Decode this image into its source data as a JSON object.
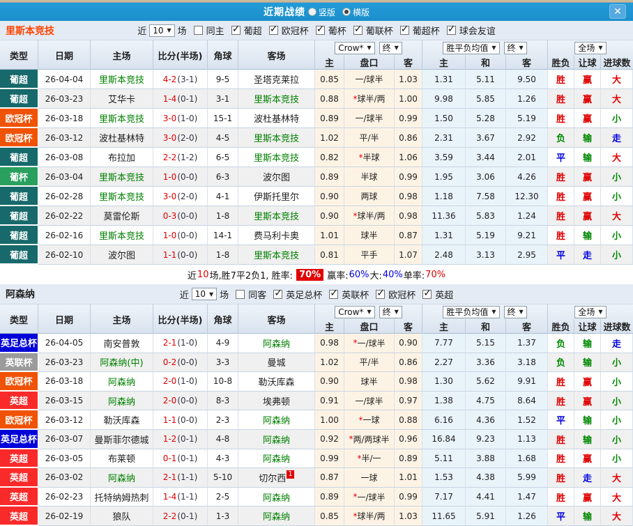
{
  "titlebar": {
    "title": "近期战绩",
    "radios": [
      {
        "label": "竖版",
        "checked": false
      },
      {
        "label": "横版",
        "checked": true
      }
    ],
    "close_label": "✕"
  },
  "table_header": {
    "type": "类型",
    "date": "日期",
    "home": "主场",
    "score": "比分(半场)",
    "corner": "角球",
    "away": "客场",
    "odds_source_dropdown": "Crow*",
    "final_dropdown": "终",
    "odds_cols": [
      "主",
      "盘口",
      "客"
    ],
    "avg_dropdown": "胜平负均值",
    "avg_final_dropdown": "终",
    "avg_cols": [
      "主",
      "和",
      "客"
    ],
    "full_dropdown": "全场",
    "result_cols": [
      "胜负",
      "让球",
      "进球数"
    ]
  },
  "league_colors": {
    "葡超": "#17696b",
    "欧冠杯": "#f05206",
    "葡杯": "#2aa05f",
    "英足总杯": "#0000d9",
    "英联杯": "#9b9b9b",
    "英超": "#fb2a2a"
  },
  "result_colors": {
    "胜": "red",
    "负": "green",
    "平": "blue",
    "赢": "red",
    "输": "green",
    "走": "blue",
    "大": "red",
    "小": "green"
  },
  "sections": [
    {
      "team": "里斯本竞技",
      "team_color": "#ff4400",
      "filter": {
        "near": "近",
        "count": "10",
        "unit": "场",
        "toggle": "同主",
        "toggle_checked": false,
        "leagues": [
          "葡超",
          "欧冠杯",
          "葡杯",
          "葡联杯",
          "葡超杯",
          "球会友谊"
        ]
      },
      "rows": [
        {
          "league": "葡超",
          "date": "26-04-04",
          "home": "里斯本竞技",
          "home_focal": true,
          "score": "4-2",
          "half": "(3-1)",
          "corner": "9-5",
          "away": "圣塔克莱拉",
          "away_focal": false,
          "away_sup": "",
          "o1": "0.85",
          "hcp": "一/球半",
          "o2": "1.03",
          "a1": "1.31",
          "a2": "5.11",
          "a3": "9.50",
          "r1": "胜",
          "r2": "赢",
          "r3": "大"
        },
        {
          "league": "葡超",
          "date": "26-03-23",
          "home": "艾华卡",
          "home_focal": false,
          "score": "1-4",
          "half": "(0-1)",
          "corner": "3-1",
          "away": "里斯本竞技",
          "away_focal": true,
          "away_sup": "",
          "o1": "0.88",
          "hcp": "*球半/两",
          "o2": "1.00",
          "a1": "9.98",
          "a2": "5.85",
          "a3": "1.26",
          "r1": "胜",
          "r2": "赢",
          "r3": "大"
        },
        {
          "league": "欧冠杯",
          "date": "26-03-18",
          "home": "里斯本竞技",
          "home_focal": true,
          "score": "3-0",
          "half": "(1-0)",
          "corner": "15-1",
          "away": "波杜基林特",
          "away_focal": false,
          "away_sup": "",
          "o1": "0.89",
          "hcp": "一/球半",
          "o2": "0.99",
          "a1": "1.50",
          "a2": "5.28",
          "a3": "5.19",
          "r1": "胜",
          "r2": "赢",
          "r3": "小"
        },
        {
          "league": "欧冠杯",
          "date": "26-03-12",
          "home": "波杜基林特",
          "home_focal": false,
          "score": "3-0",
          "half": "(2-0)",
          "corner": "4-5",
          "away": "里斯本竞技",
          "away_focal": true,
          "away_sup": "",
          "o1": "1.02",
          "hcp": "平/半",
          "o2": "0.86",
          "a1": "2.31",
          "a2": "3.67",
          "a3": "2.92",
          "r1": "负",
          "r2": "输",
          "r3": "走"
        },
        {
          "league": "葡超",
          "date": "26-03-08",
          "home": "布拉加",
          "home_focal": false,
          "score": "2-2",
          "half": "(1-2)",
          "corner": "6-5",
          "away": "里斯本竞技",
          "away_focal": true,
          "away_sup": "",
          "o1": "0.82",
          "hcp": "*半球",
          "o2": "1.06",
          "a1": "3.59",
          "a2": "3.44",
          "a3": "2.01",
          "r1": "平",
          "r2": "输",
          "r3": "大"
        },
        {
          "league": "葡杯",
          "date": "26-03-04",
          "home": "里斯本竞技",
          "home_focal": true,
          "score": "1-0",
          "half": "(0-0)",
          "corner": "6-3",
          "away": "波尔图",
          "away_focal": false,
          "away_sup": "",
          "o1": "0.89",
          "hcp": "半球",
          "o2": "0.99",
          "a1": "1.95",
          "a2": "3.06",
          "a3": "4.26",
          "r1": "胜",
          "r2": "赢",
          "r3": "小"
        },
        {
          "league": "葡超",
          "date": "26-02-28",
          "home": "里斯本竞技",
          "home_focal": true,
          "score": "3-0",
          "half": "(2-0)",
          "corner": "4-1",
          "away": "伊斯托里尔",
          "away_focal": false,
          "away_sup": "",
          "o1": "0.90",
          "hcp": "两球",
          "o2": "0.98",
          "a1": "1.18",
          "a2": "7.58",
          "a3": "12.30",
          "r1": "胜",
          "r2": "赢",
          "r3": "小"
        },
        {
          "league": "葡超",
          "date": "26-02-22",
          "home": "莫雷伦斯",
          "home_focal": false,
          "score": "0-3",
          "half": "(0-0)",
          "corner": "1-8",
          "away": "里斯本竞技",
          "away_focal": true,
          "away_sup": "",
          "o1": "0.90",
          "hcp": "*球半/两",
          "o2": "0.98",
          "a1": "11.36",
          "a2": "5.83",
          "a3": "1.24",
          "r1": "胜",
          "r2": "赢",
          "r3": "大"
        },
        {
          "league": "葡超",
          "date": "26-02-16",
          "home": "里斯本竞技",
          "home_focal": true,
          "score": "1-0",
          "half": "(0-0)",
          "corner": "14-1",
          "away": "费马利卡奥",
          "away_focal": false,
          "away_sup": "",
          "o1": "1.01",
          "hcp": "球半",
          "o2": "0.87",
          "a1": "1.31",
          "a2": "5.19",
          "a3": "9.21",
          "r1": "胜",
          "r2": "输",
          "r3": "小"
        },
        {
          "league": "葡超",
          "date": "26-02-10",
          "home": "波尔图",
          "home_focal": false,
          "score": "1-1",
          "half": "(0-0)",
          "corner": "1-8",
          "away": "里斯本竞技",
          "away_focal": true,
          "away_sup": "",
          "o1": "0.81",
          "hcp": "平手",
          "o2": "1.07",
          "a1": "2.48",
          "a2": "3.13",
          "a3": "2.95",
          "r1": "平",
          "r2": "走",
          "r3": "小"
        }
      ],
      "summary": [
        {
          "text": "近",
          "style": "plain"
        },
        {
          "text": "10",
          "style": "red"
        },
        {
          "text": "场,胜7平2负1, 胜率:",
          "style": "plain"
        },
        {
          "text": "70%",
          "style": "badge"
        },
        {
          "text": "赢率:",
          "style": "plain"
        },
        {
          "text": "60%",
          "style": "blue"
        },
        {
          "text": " 大:",
          "style": "plain"
        },
        {
          "text": "40%",
          "style": "blue"
        },
        {
          "text": " 单率:",
          "style": "plain"
        },
        {
          "text": "70%",
          "style": "red"
        }
      ]
    },
    {
      "team": "阿森纳",
      "team_color": "#222222",
      "filter": {
        "near": "近",
        "count": "10",
        "unit": "场",
        "toggle": "同客",
        "toggle_checked": false,
        "leagues": [
          "英足总杯",
          "英联杯",
          "欧冠杯",
          "英超"
        ]
      },
      "rows": [
        {
          "league": "英足总杯",
          "date": "26-04-05",
          "home": "南安普敦",
          "home_focal": false,
          "score": "2-1",
          "half": "(1-0)",
          "corner": "4-9",
          "away": "阿森纳",
          "away_focal": true,
          "away_sup": "",
          "o1": "0.98",
          "hcp": "*一/球半",
          "o2": "0.90",
          "a1": "7.77",
          "a2": "5.15",
          "a3": "1.37",
          "r1": "负",
          "r2": "输",
          "r3": "走"
        },
        {
          "league": "英联杯",
          "date": "26-03-23",
          "home": "阿森纳(中)",
          "home_focal": true,
          "score": "0-2",
          "half": "(0-0)",
          "corner": "3-3",
          "away": "曼城",
          "away_focal": false,
          "away_sup": "",
          "o1": "1.02",
          "hcp": "平/半",
          "o2": "0.86",
          "a1": "2.27",
          "a2": "3.36",
          "a3": "3.18",
          "r1": "负",
          "r2": "输",
          "r3": "小"
        },
        {
          "league": "欧冠杯",
          "date": "26-03-18",
          "home": "阿森纳",
          "home_focal": true,
          "score": "2-0",
          "half": "(1-0)",
          "corner": "10-8",
          "away": "勒沃库森",
          "away_focal": false,
          "away_sup": "",
          "o1": "0.90",
          "hcp": "球半",
          "o2": "0.98",
          "a1": "1.30",
          "a2": "5.62",
          "a3": "9.91",
          "r1": "胜",
          "r2": "赢",
          "r3": "小"
        },
        {
          "league": "英超",
          "date": "26-03-15",
          "home": "阿森纳",
          "home_focal": true,
          "score": "2-0",
          "half": "(0-0)",
          "corner": "8-3",
          "away": "埃弗顿",
          "away_focal": false,
          "away_sup": "",
          "o1": "0.91",
          "hcp": "一/球半",
          "o2": "0.97",
          "a1": "1.38",
          "a2": "4.75",
          "a3": "8.64",
          "r1": "胜",
          "r2": "赢",
          "r3": "小"
        },
        {
          "league": "欧冠杯",
          "date": "26-03-12",
          "home": "勒沃库森",
          "home_focal": false,
          "score": "1-1",
          "half": "(0-0)",
          "corner": "2-3",
          "away": "阿森纳",
          "away_focal": true,
          "away_sup": "",
          "o1": "1.00",
          "hcp": "*一球",
          "o2": "0.88",
          "a1": "6.16",
          "a2": "4.36",
          "a3": "1.52",
          "r1": "平",
          "r2": "输",
          "r3": "小"
        },
        {
          "league": "英足总杯",
          "date": "26-03-07",
          "home": "曼斯菲尔德城",
          "home_focal": false,
          "score": "1-2",
          "half": "(0-1)",
          "corner": "4-8",
          "away": "阿森纳",
          "away_focal": true,
          "away_sup": "",
          "o1": "0.92",
          "hcp": "*两/两球半",
          "o2": "0.96",
          "a1": "16.84",
          "a2": "9.23",
          "a3": "1.13",
          "r1": "胜",
          "r2": "输",
          "r3": "小"
        },
        {
          "league": "英超",
          "date": "26-03-05",
          "home": "布莱顿",
          "home_focal": false,
          "score": "0-1",
          "half": "(0-1)",
          "corner": "4-3",
          "away": "阿森纳",
          "away_focal": true,
          "away_sup": "",
          "o1": "0.99",
          "hcp": "*半/一",
          "o2": "0.89",
          "a1": "5.11",
          "a2": "3.88",
          "a3": "1.68",
          "r1": "胜",
          "r2": "赢",
          "r3": "小"
        },
        {
          "league": "英超",
          "date": "26-03-02",
          "home": "阿森纳",
          "home_focal": true,
          "score": "2-1",
          "half": "(1-1)",
          "corner": "5-10",
          "away": "切尔西",
          "away_focal": false,
          "away_sup": "1",
          "o1": "0.87",
          "hcp": "一球",
          "o2": "1.01",
          "a1": "1.53",
          "a2": "4.38",
          "a3": "5.99",
          "r1": "胜",
          "r2": "走",
          "r3": "大"
        },
        {
          "league": "英超",
          "date": "26-02-23",
          "home": "托特纳姆热刺",
          "home_focal": false,
          "score": "1-4",
          "half": "(1-1)",
          "corner": "2-5",
          "away": "阿森纳",
          "away_focal": true,
          "away_sup": "",
          "o1": "0.89",
          "hcp": "*一/球半",
          "o2": "0.99",
          "a1": "7.17",
          "a2": "4.41",
          "a3": "1.47",
          "r1": "胜",
          "r2": "赢",
          "r3": "大"
        },
        {
          "league": "英超",
          "date": "26-02-19",
          "home": "狼队",
          "home_focal": false,
          "score": "2-2",
          "half": "(0-1)",
          "corner": "1-3",
          "away": "阿森纳",
          "away_focal": true,
          "away_sup": "",
          "o1": "0.85",
          "hcp": "*球半/两",
          "o2": "1.03",
          "a1": "11.65",
          "a2": "5.91",
          "a3": "1.26",
          "r1": "平",
          "r2": "输",
          "r3": "大"
        }
      ],
      "summary": null
    }
  ]
}
